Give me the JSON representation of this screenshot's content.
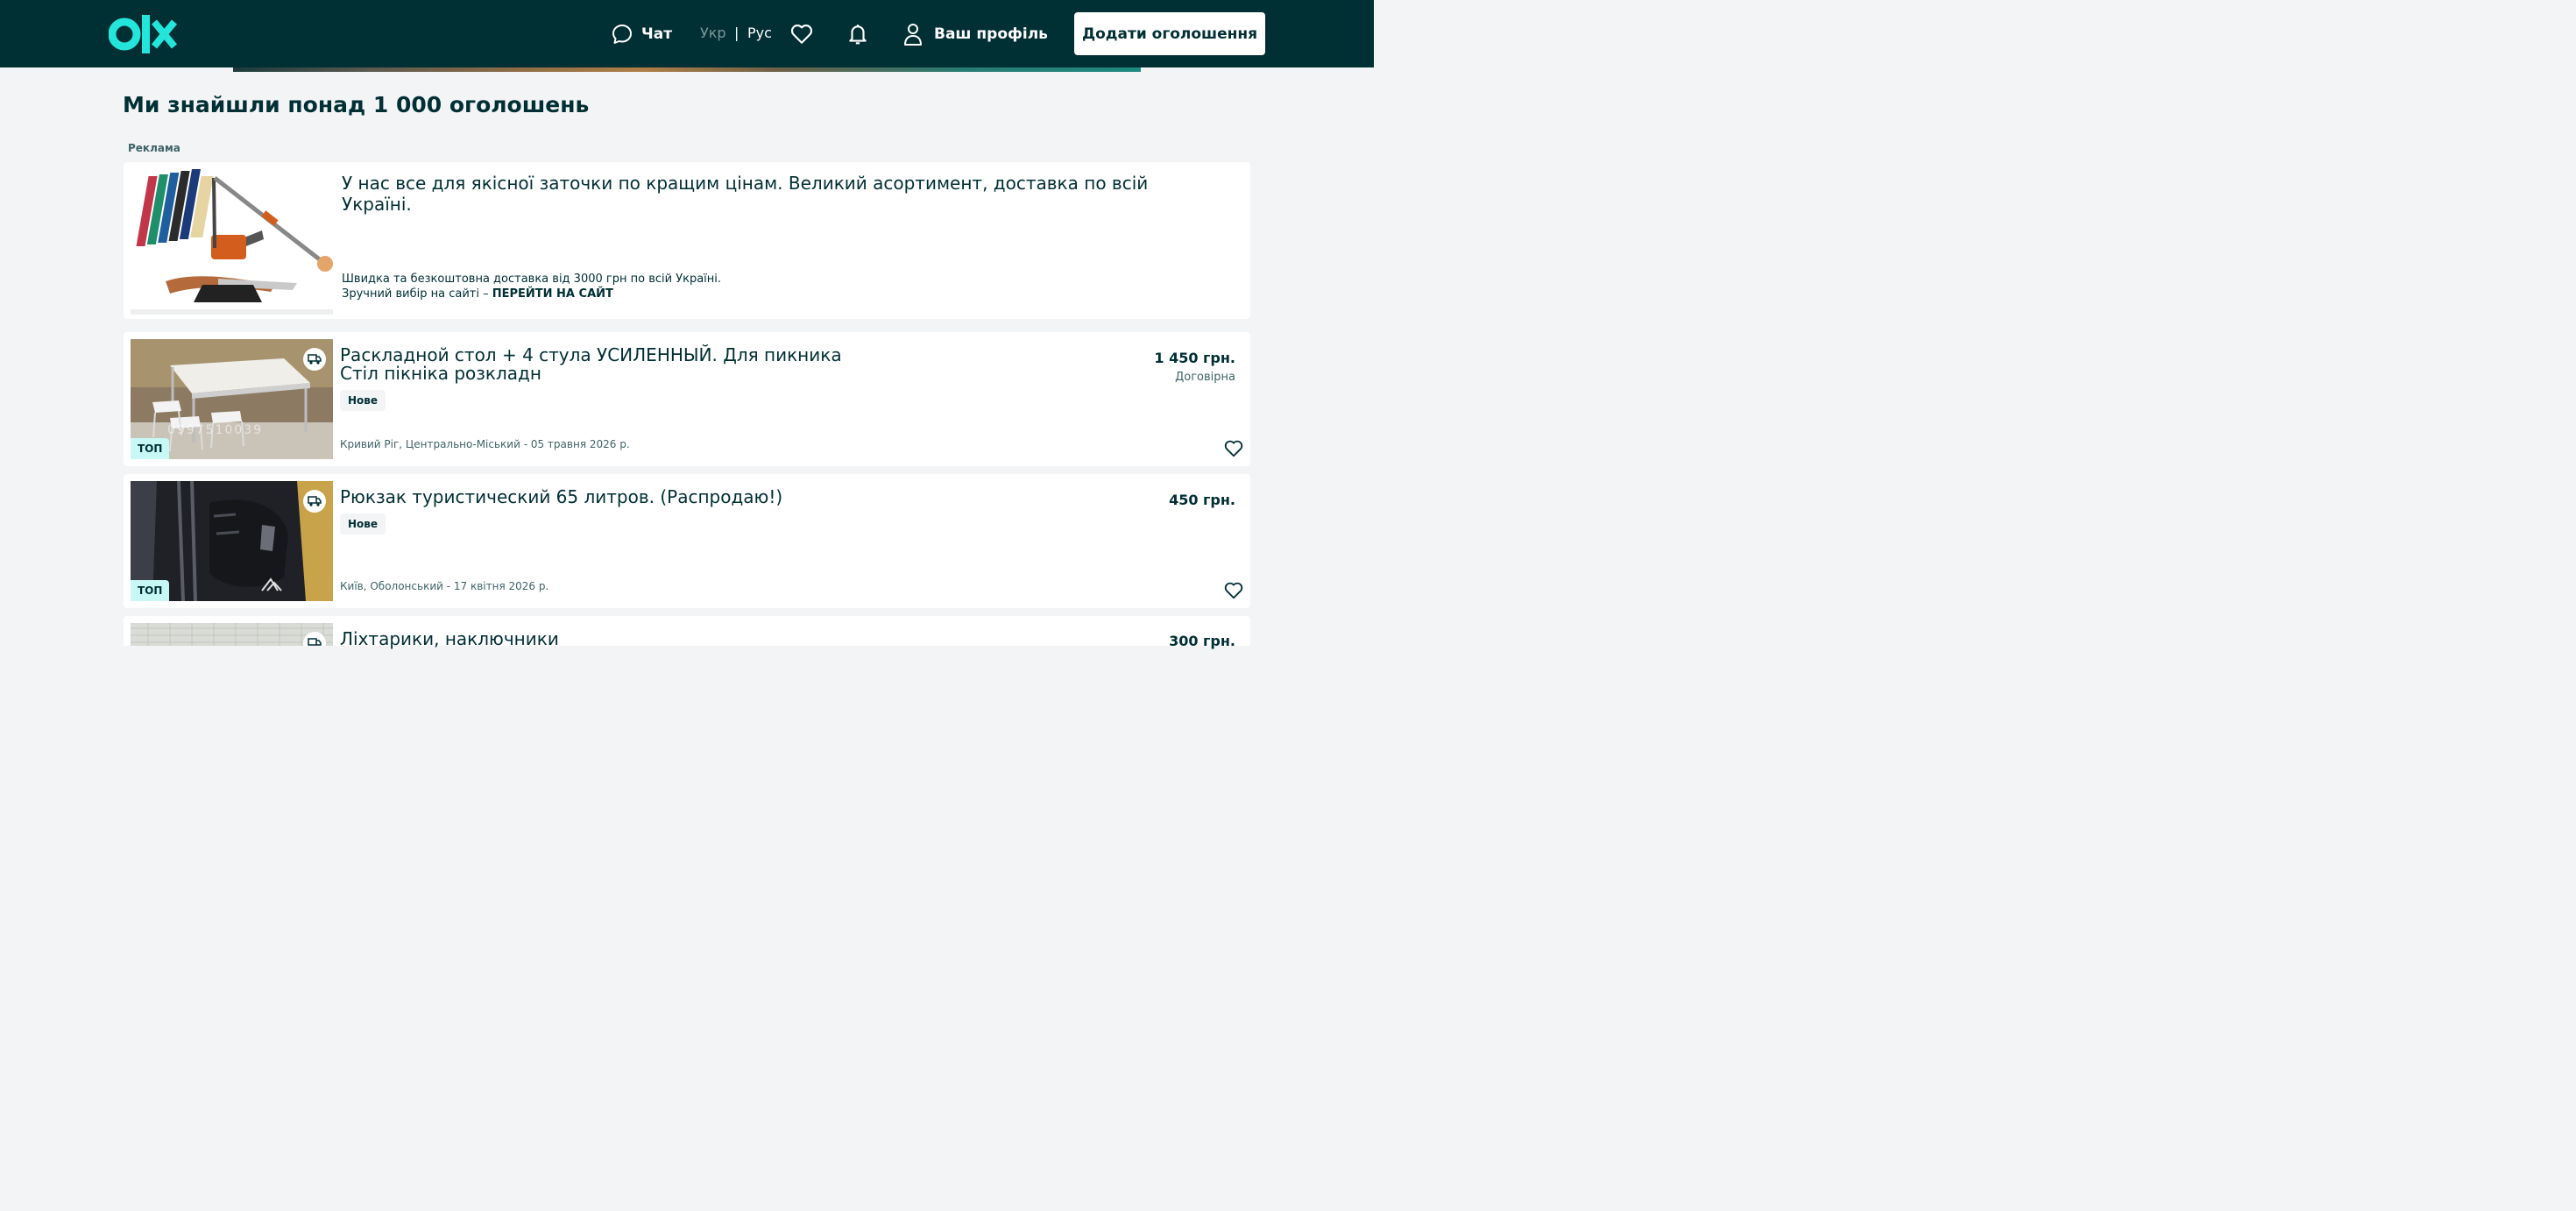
{
  "header": {
    "chat_label": "Чат",
    "lang_ukr": "Укр",
    "lang_separator": "|",
    "lang_rus": "Рус",
    "profile_label": "Ваш профіль",
    "add_button_label": "Додати оголошення"
  },
  "page": {
    "title": "Ми знайшли понад 1 000 оголошень",
    "ad_label": "Реклама"
  },
  "ad": {
    "title": "У нас все для якісної заточки по кращим цінам. Великий асортимент, доставка по всій Україні.",
    "desc_line1": "Швидка та безкоштовна доставка від 3000 грн по всій Україні.",
    "desc_line2_prefix": "Зручний вибір на сайті – ",
    "desc_line2_link": "ПЕРЕЙТИ НА САЙТ"
  },
  "listings": [
    {
      "title": "Раскладной стол + 4 стула УСИЛЕННЫЙ. Для пикника Стіл пікніка розкладн",
      "condition": "Нове",
      "price": "1 450 грн.",
      "negotiable": "Договірна",
      "location_date": "Кривий Ріг, Центрально-Міський - 05 травня 2026 р.",
      "top_badge": "ТОП",
      "watermark": "0997510039"
    },
    {
      "title": "Рюкзак туристический 65 литров. (Распродаю!)",
      "condition": "Нове",
      "price": "450 грн.",
      "location_date": "Київ, Оболонський - 17 квітня 2026 р.",
      "top_badge": "ТОП"
    },
    {
      "title": "Ліхтарики, наключники",
      "price": "300 грн."
    }
  ],
  "colors": {
    "header_bg": "#002f34",
    "brand_teal": "#23e5db",
    "page_bg": "#f2f4f5",
    "top_badge_bg": "#c8f8f6"
  },
  "icons": [
    "olx-logo",
    "chat-icon",
    "heart-icon",
    "bell-icon",
    "user-icon",
    "delivery-icon"
  ]
}
